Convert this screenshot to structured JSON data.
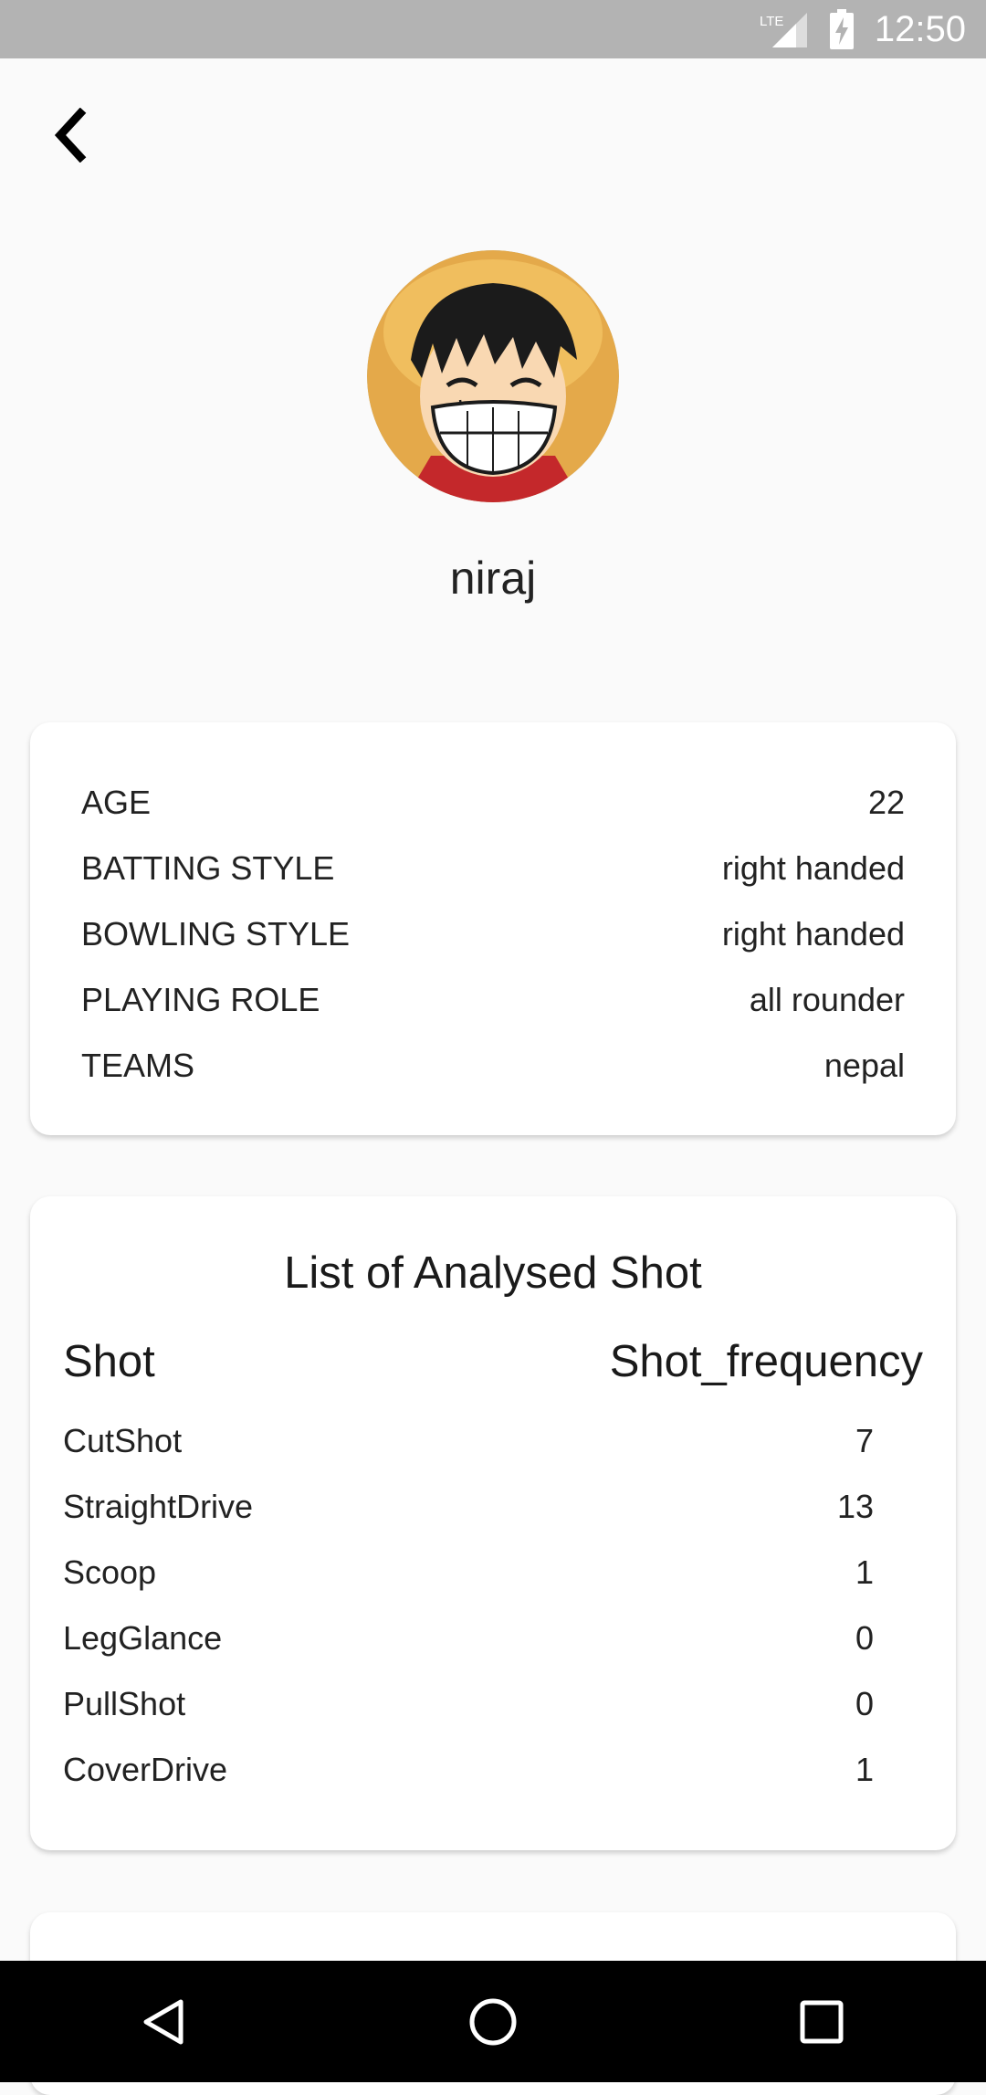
{
  "status_bar": {
    "network": "LTE",
    "time": "12:50"
  },
  "profile": {
    "name": "niraj"
  },
  "info": [
    {
      "label": "AGE",
      "value": "22"
    },
    {
      "label": "BATTING STYLE",
      "value": "right handed"
    },
    {
      "label": "BOWLING STYLE",
      "value": "right handed"
    },
    {
      "label": "PLAYING ROLE",
      "value": "all rounder"
    },
    {
      "label": "TEAMS",
      "value": "nepal"
    }
  ],
  "shots": {
    "title": "List of Analysed Shot",
    "header": {
      "shot": "Shot",
      "frequency": "Shot_frequency"
    },
    "rows": [
      {
        "shot": "CutShot",
        "frequency": "7"
      },
      {
        "shot": "StraightDrive",
        "frequency": "13"
      },
      {
        "shot": "Scoop",
        "frequency": "1"
      },
      {
        "shot": "LegGlance",
        "frequency": "0"
      },
      {
        "shot": "PullShot",
        "frequency": "0"
      },
      {
        "shot": "CoverDrive",
        "frequency": "1"
      }
    ]
  },
  "icons": {
    "back": "chevron-left-icon",
    "signal": "signal-icon",
    "battery": "battery-charging-icon",
    "nav_back": "triangle-back-icon",
    "nav_home": "circle-home-icon",
    "nav_recents": "square-recents-icon"
  },
  "colors": {
    "status_bar": "#b3b3b3",
    "background": "#fafafa",
    "nav_bar": "#000000"
  }
}
